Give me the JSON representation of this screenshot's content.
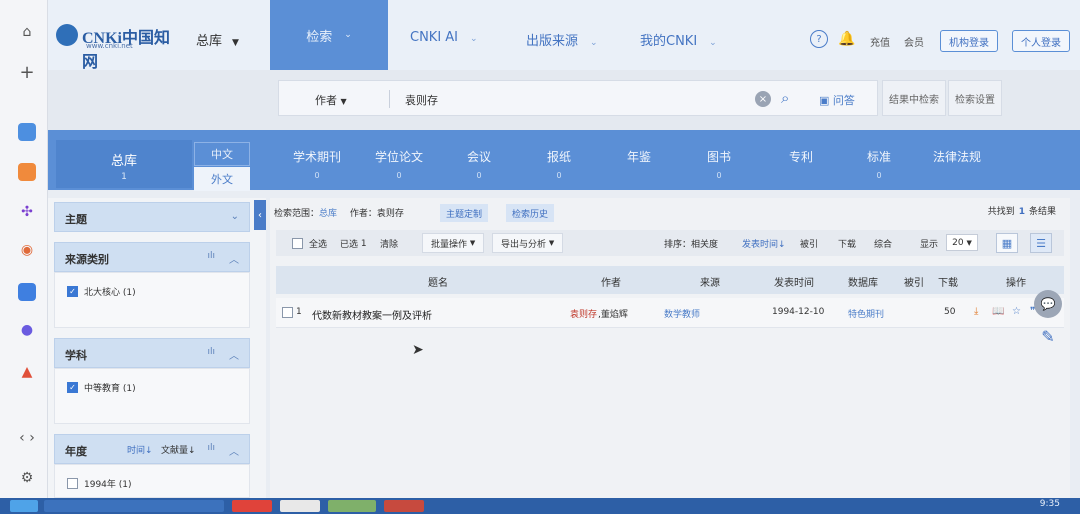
{
  "header": {
    "logo_text": "CNKi中国知网",
    "logo_url": "www.cnki.net",
    "scope_tab": "总库",
    "nav": [
      "检索",
      "CNKI AI",
      "出版来源",
      "我的CNKI"
    ],
    "recharge": "充值",
    "member": "会员",
    "org_login": "机构登录",
    "personal_login": "个人登录"
  },
  "search": {
    "field": "作者",
    "value": "袁则存",
    "ask_label": "问答",
    "within_results": "结果中检索",
    "settings": "检索设置"
  },
  "db_tabs": {
    "main": {
      "label": "总库",
      "count": "1"
    },
    "lang_cn": "中文",
    "lang_foreign": "外文",
    "items": [
      {
        "label": "学术期刊",
        "count": "0"
      },
      {
        "label": "学位论文",
        "count": "0"
      },
      {
        "label": "会议",
        "count": "0"
      },
      {
        "label": "报纸",
        "count": "0"
      },
      {
        "label": "年鉴",
        "count": ""
      },
      {
        "label": "图书",
        "count": "0"
      },
      {
        "label": "专利",
        "count": ""
      },
      {
        "label": "标准",
        "count": "0"
      },
      {
        "label": "法律法规",
        "count": ""
      }
    ]
  },
  "filters": {
    "topic": "主题",
    "source_type": {
      "title": "来源类别",
      "items": [
        {
          "label": "北大核心 (1)",
          "checked": true
        }
      ]
    },
    "subject": {
      "title": "学科",
      "items": [
        {
          "label": "中等教育 (1)",
          "checked": true
        }
      ]
    },
    "year": {
      "title": "年度",
      "sort_time": "时间↓",
      "sort_count": "文献量↓",
      "items": [
        {
          "label": "1994年 (1)",
          "checked": false
        }
      ]
    }
  },
  "results": {
    "scope_label": "检索范围：",
    "scope_value": "总库",
    "author_label": "作者：袁则存",
    "topic_custom": "主题定制",
    "search_history": "检索历史",
    "total_prefix": "共找到",
    "total_count": "1",
    "total_suffix": "条结果",
    "select_all": "全选",
    "selected": "已选",
    "selected_count": "1",
    "clear": "清除",
    "batch": "批量操作",
    "export": "导出与分析",
    "sort_label": "排序：相关度",
    "sort_date": "发表时间↓",
    "sort_cited": "被引",
    "sort_download": "下载",
    "sort_综合": "综合",
    "show_label": "显示",
    "page_size": "20",
    "columns": [
      "题名",
      "作者",
      "来源",
      "发表时间",
      "数据库",
      "被引",
      "下载",
      "操作"
    ],
    "rows": [
      {
        "index": "1",
        "title": "代数新教材教案一例及评析",
        "author_main": "袁则存",
        "author_other": ",董焰辉",
        "source": "数学教师",
        "date": "1994-12-10",
        "db": "特色期刊",
        "cited": "",
        "downloads": "50"
      }
    ]
  },
  "taskbar": {
    "time": "9:35"
  },
  "colors": {
    "accent": "#5b8fd6",
    "brand": "#2b5da3",
    "highlight": "#c0392b"
  }
}
